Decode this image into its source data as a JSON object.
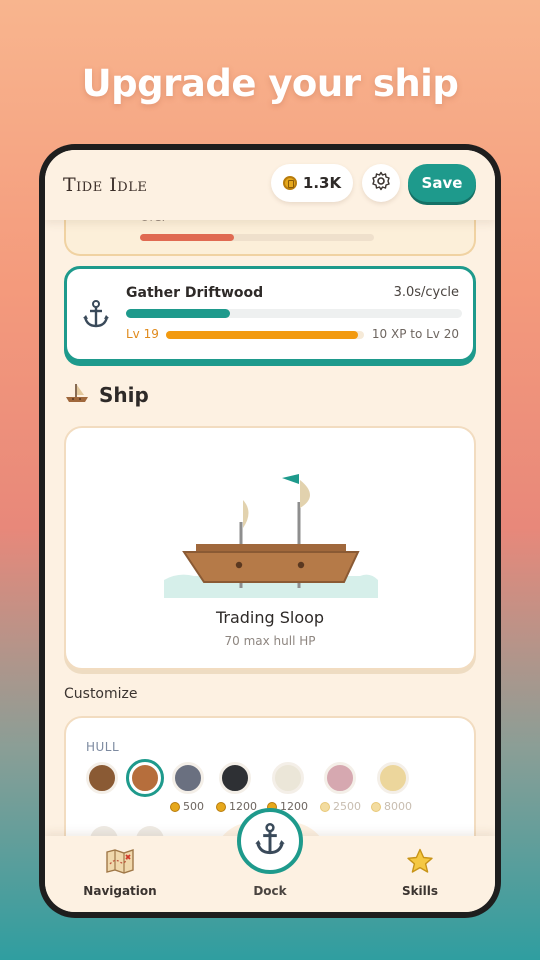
{
  "headline": "Upgrade your ship",
  "app": {
    "title": "Tide Idle",
    "coins": "1.3K",
    "save_label": "Save"
  },
  "ore_card": {
    "label": "Ore.",
    "progress": 0.4
  },
  "task": {
    "name": "Gather Driftwood",
    "rate": "3.0s/cycle",
    "progress": 0.31,
    "level_label": "Lv 19",
    "xp_progress": 0.97,
    "xp_text": "10 XP to Lv 20"
  },
  "ship_section": {
    "title": "Ship",
    "ship_name": "Trading Sloop",
    "ship_hp": "70 max hull HP"
  },
  "customize": {
    "label": "Customize",
    "hull_label": "HULL",
    "swatches": [
      {
        "color": "#8a5a34",
        "price": ""
      },
      {
        "color": "#b66e3c",
        "price": "",
        "selected": true
      },
      {
        "color": "#6a7080",
        "price": "500"
      },
      {
        "color": "#2e3034",
        "price": "1200"
      },
      {
        "color": "#ebe6d8",
        "price": "1200"
      },
      {
        "color": "#d6a8b0",
        "price": "2500",
        "locked": true
      },
      {
        "color": "#ecd69c",
        "price": "8000",
        "locked": true
      }
    ]
  },
  "nav": {
    "navigation": "Navigation",
    "dock": "Dock",
    "skills": "Skills"
  }
}
